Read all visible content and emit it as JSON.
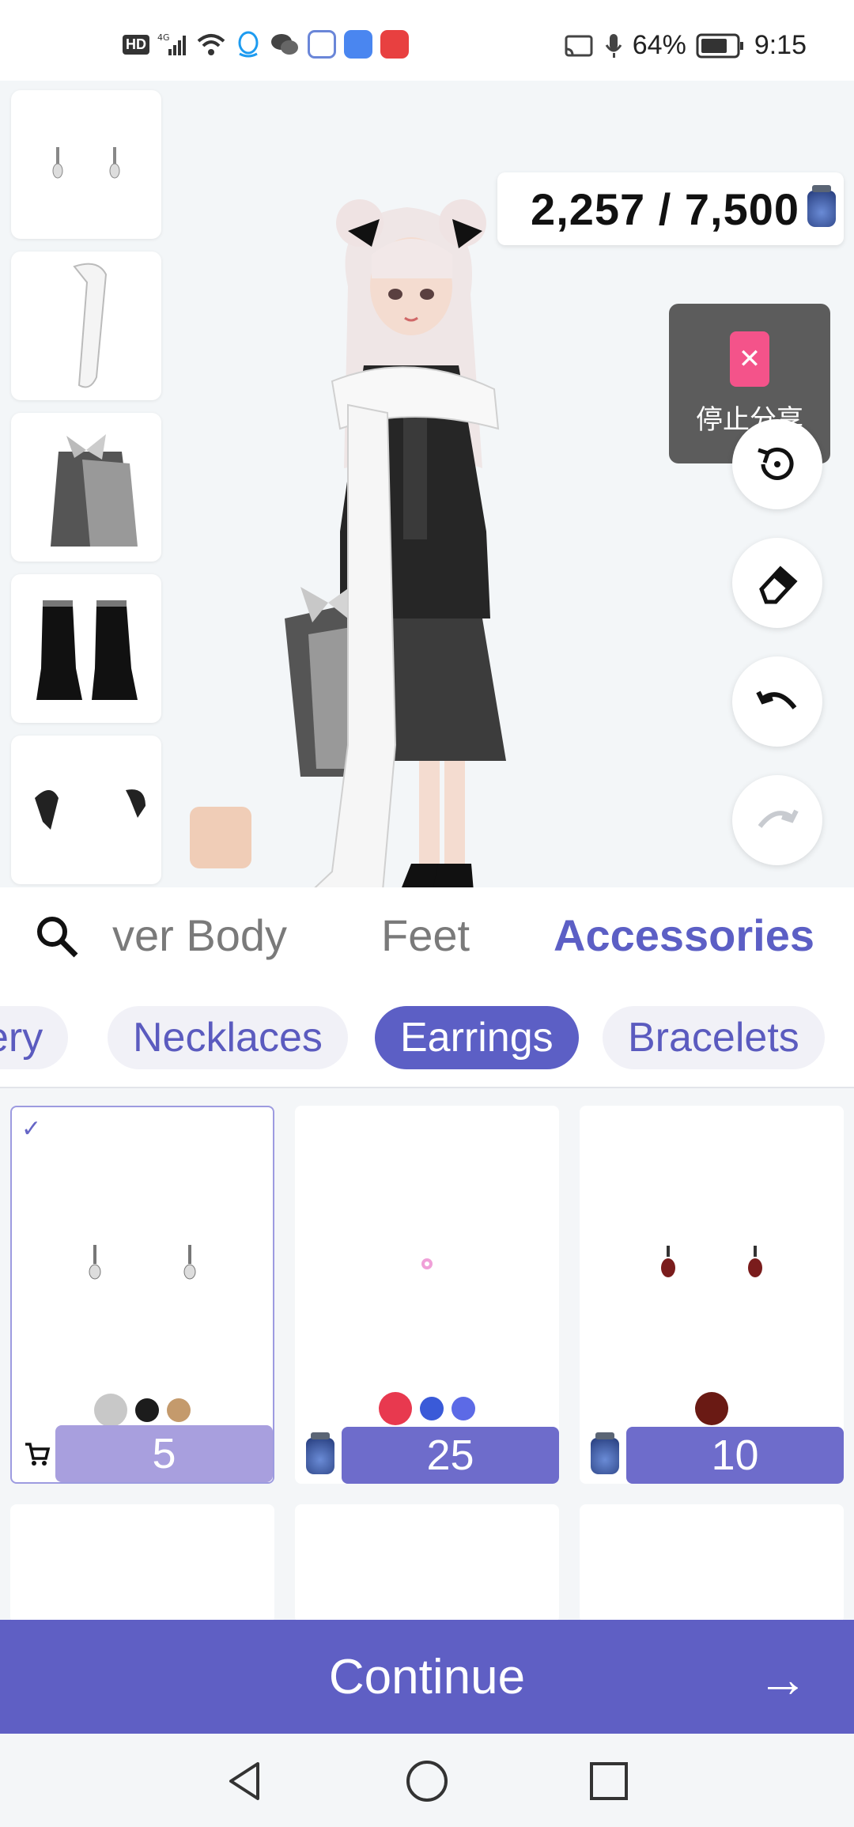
{
  "status_bar": {
    "network": "4G",
    "battery_percent": "64%",
    "time": "9:15",
    "left_icons": [
      "hd-icon",
      "signal-icon",
      "wifi-icon",
      "qq-icon",
      "wechat-icon",
      "app-icon",
      "music-icon",
      "book-icon"
    ],
    "right_icons": [
      "cast-icon",
      "mic-icon",
      "battery-icon"
    ]
  },
  "currency": {
    "value": "2,257 / 7,500",
    "icon": "jar-icon"
  },
  "share_panel": {
    "label": "停止分享"
  },
  "side_buttons": [
    "reset-icon",
    "eraser-icon",
    "undo-icon",
    "redo-icon"
  ],
  "categories": {
    "items": [
      {
        "label": "ver Body"
      },
      {
        "label": "Feet"
      },
      {
        "label": "Accessories",
        "active": true
      }
    ]
  },
  "subcategories": {
    "items": [
      {
        "label": "ery"
      },
      {
        "label": "Necklaces"
      },
      {
        "label": "Earrings",
        "active": true
      },
      {
        "label": "Bracelets"
      }
    ]
  },
  "items": [
    {
      "selected": true,
      "price": "5",
      "currency_icon": "cart-icon",
      "swatches": [
        "#c8c8c8",
        "#1c1c1c",
        "#c49a6c"
      ]
    },
    {
      "selected": false,
      "price": "25",
      "currency_icon": "jar-icon",
      "swatches": [
        "#e8394f",
        "#3a5ad8",
        "#5c6ae6"
      ]
    },
    {
      "selected": false,
      "price": "10",
      "currency_icon": "jar-icon",
      "swatches": [
        "#6a1a14"
      ]
    }
  ],
  "continue_button": {
    "label": "Continue"
  },
  "nav": [
    "back-icon",
    "home-icon",
    "recents-icon"
  ],
  "colors": {
    "accent": "#5f5fc4",
    "share_panel": "#5c5c5c",
    "skin": "#f0cdb7"
  }
}
